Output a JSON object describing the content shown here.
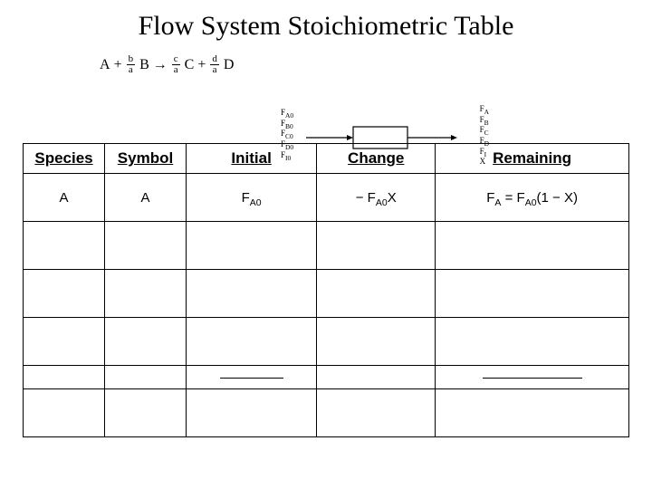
{
  "title": "Flow System Stoichiometric Table",
  "reaction": {
    "A": "A",
    "plus": "+",
    "ba_num": "b",
    "ba_den": "a",
    "B": "B",
    "arrow": "→",
    "ca_num": "c",
    "ca_den": "a",
    "C": "C",
    "da_num": "d",
    "da_den": "a",
    "D": "D"
  },
  "reactor": {
    "in": [
      "F_A0",
      "F_B0",
      "F_C0",
      "F_D0",
      "F_I0"
    ],
    "out": [
      "F_A",
      "F_B",
      "F_C",
      "F_D",
      "F_I",
      "X"
    ]
  },
  "headers": {
    "species": "Species",
    "symbol": "Symbol",
    "initial": "Initial",
    "change": "Change",
    "remaining": "Remaining"
  },
  "rowA": {
    "species": "A",
    "symbol": "A",
    "initial_html": "F<span class='sub'>A0</span>",
    "change_html": "− F<span class='sub'>A0</span>X",
    "remaining_html": "F<span class='sub'>A</span> = F<span class='sub'>A0</span>(1 − X)"
  }
}
